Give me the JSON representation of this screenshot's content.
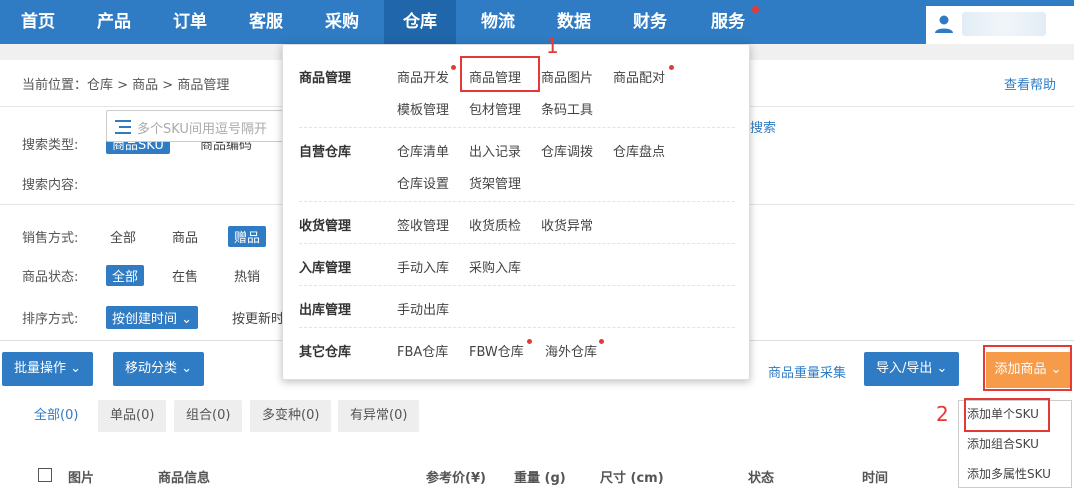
{
  "nav": {
    "items": [
      "首页",
      "产品",
      "订单",
      "客服",
      "采购",
      "仓库",
      "物流",
      "数据",
      "财务",
      "服务"
    ],
    "active": "仓库"
  },
  "breadcrumb": "当前位置：仓库 > 商品 > 商品管理",
  "help": "查看帮助",
  "search": {
    "type_label": "搜索类型:",
    "type_options": [
      "商品SKU",
      "商品编码"
    ],
    "content_label": "搜索内容:",
    "placeholder": "多个SKU间用逗号隔开",
    "button": "搜索"
  },
  "filters": {
    "sale_label": "销售方式:",
    "sale_options": [
      "全部",
      "商品",
      "赠品"
    ],
    "status_label": "商品状态:",
    "status_options": [
      "全部",
      "在售",
      "热销"
    ],
    "sort_label": "排序方式:",
    "sort_selected": "按创建时间",
    "sort_other": "按更新时"
  },
  "mega_menu": {
    "sections": [
      {
        "title": "商品管理",
        "rows": [
          [
            "商品开发",
            "商品管理",
            "商品图片",
            "商品配对"
          ],
          [
            "模板管理",
            "包材管理",
            "条码工具"
          ]
        ]
      },
      {
        "title": "自营仓库",
        "rows": [
          [
            "仓库清单",
            "出入记录",
            "仓库调拨",
            "仓库盘点"
          ],
          [
            "仓库设置",
            "货架管理"
          ]
        ]
      },
      {
        "title": "收货管理",
        "rows": [
          [
            "签收管理",
            "收货质检",
            "收货异常"
          ]
        ]
      },
      {
        "title": "入库管理",
        "rows": [
          [
            "手动入库",
            "采购入库"
          ]
        ]
      },
      {
        "title": "出库管理",
        "rows": [
          [
            "手动出库"
          ]
        ]
      },
      {
        "title": "其它仓库",
        "rows": [
          [
            "FBA仓库",
            "FBW仓库",
            "海外仓库"
          ]
        ]
      }
    ]
  },
  "toolbar": {
    "batch": "批量操作",
    "move": "移动分类",
    "bulk_collect": "商品重量采集",
    "import_export": "导入/导出",
    "add_product": "添加商品"
  },
  "add_menu": [
    "添加单个SKU",
    "添加组合SKU",
    "添加多属性SKU"
  ],
  "tabs": [
    "全部(0)",
    "单品(0)",
    "组合(0)",
    "多变种(0)",
    "有异常(0)"
  ],
  "table_headers": [
    "图片",
    "商品信息",
    "参考价(¥)",
    "重量 (g)",
    "尺寸 (cm)",
    "状态",
    "时间"
  ],
  "annotations": {
    "step1": "1",
    "step2": "2"
  },
  "colors": {
    "primary": "#2f7cc4",
    "orange": "#f59b4a",
    "highlight": "#e53935"
  }
}
